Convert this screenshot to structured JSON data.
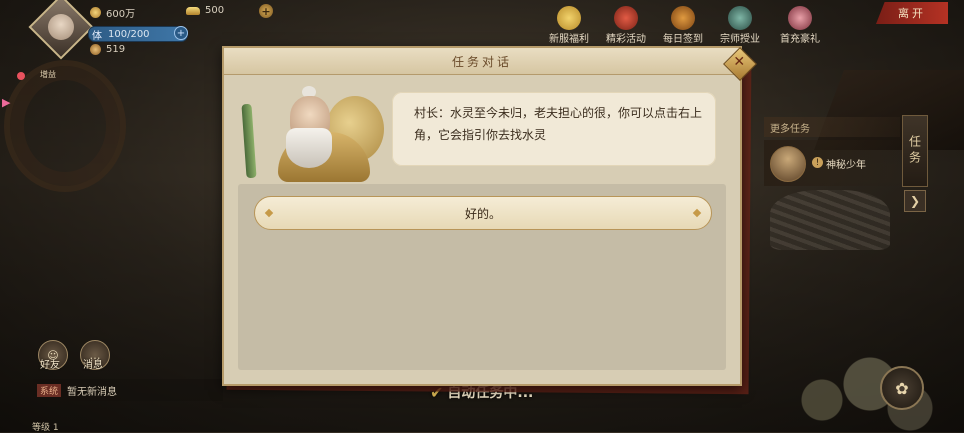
{
  "player": {
    "silver": "600万",
    "gold": "500",
    "stamina_label": "体",
    "stamina": "100/200",
    "other_resource": "519"
  },
  "events": [
    {
      "label": "新服福利",
      "icon": "gift-icon"
    },
    {
      "label": "精彩活动",
      "icon": "lantern-icon"
    },
    {
      "label": "每日签到",
      "icon": "calendar-icon"
    },
    {
      "label": "宗师授业",
      "icon": "master-icon"
    },
    {
      "label": "首充豪礼",
      "icon": "recharge-icon"
    }
  ],
  "leave_label": "离开",
  "side_label": "增益",
  "dialog": {
    "title": "任务对话",
    "speech": "村长：水灵至今未归，老夫担心的很，你可以点击右上角，它会指引你去找水灵",
    "choices": [
      "好的。"
    ]
  },
  "tasks": {
    "more_label": "更多任务",
    "tab_label": "任务",
    "items": [
      {
        "name": "神秘少年"
      }
    ]
  },
  "social": {
    "friends": "好友",
    "messages": "消息"
  },
  "chat": {
    "tag": "系统",
    "text": "暂无新消息"
  },
  "level_label": "等级 1",
  "auto_task": "自动任务中...",
  "colors": {
    "accent": "#b53224",
    "panel": "#d7cdb4",
    "gold": "#e9c35a"
  }
}
